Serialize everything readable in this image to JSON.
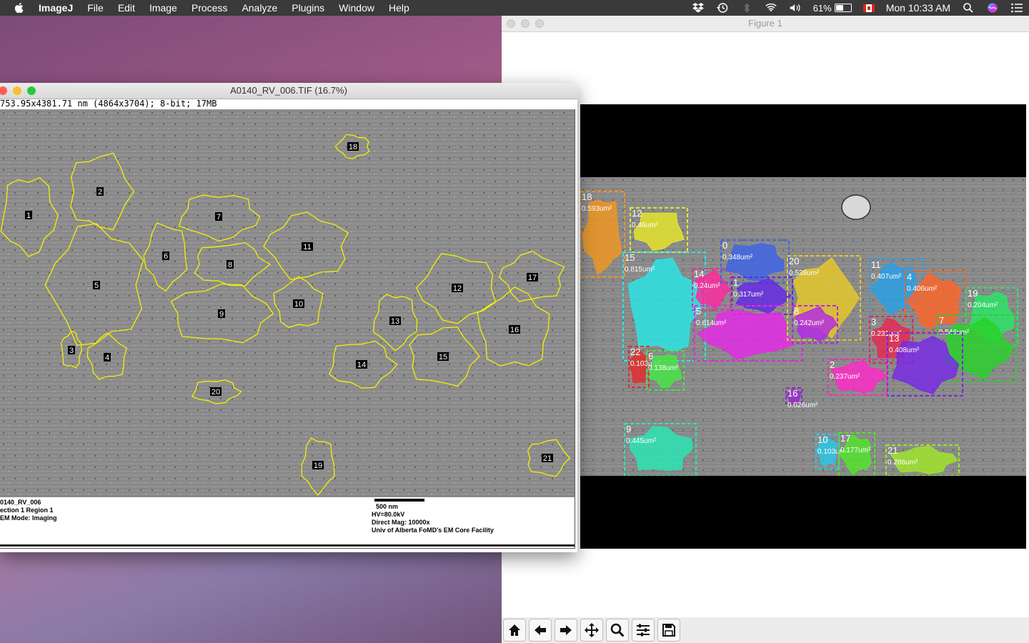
{
  "menubar": {
    "app_name": "ImageJ",
    "items": [
      "File",
      "Edit",
      "Image",
      "Process",
      "Analyze",
      "Plugins",
      "Window",
      "Help"
    ],
    "battery_percent": "61%",
    "battery_level": 0.61,
    "clock": "Mon 10:33 AM"
  },
  "figure_window": {
    "title": "Figure 1",
    "toolbar": [
      "home-icon",
      "back-arrow-icon",
      "forward-arrow-icon",
      "pan-icon",
      "zoom-icon",
      "configure-subplots-icon",
      "save-icon"
    ],
    "segments": [
      {
        "id": "18",
        "area": "0.593um²",
        "color": "#f0961e"
      },
      {
        "id": "12",
        "area": "0.46um²",
        "color": "#e6e628"
      },
      {
        "id": "15",
        "area": "0.815um²",
        "color": "#28e6e6"
      },
      {
        "id": "14",
        "area": "0.24um²",
        "color": "#ff28a0"
      },
      {
        "id": "0",
        "area": "0.348um²",
        "color": "#3c64e6"
      },
      {
        "id": "1",
        "area": "0.317um²",
        "color": "#6428e6"
      },
      {
        "id": "5",
        "area": "0.614um²",
        "color": "#e628e6"
      },
      {
        "id": "20",
        "area": "0.538um²",
        "color": "#e6c828"
      },
      {
        "id": "8",
        "area": "0.242um²",
        "color": "#b428e6"
      },
      {
        "id": "11",
        "area": "0.407um²",
        "color": "#28a0e6"
      },
      {
        "id": "4",
        "area": "0.406um²",
        "color": "#ff6428"
      },
      {
        "id": "19",
        "area": "0.204um²",
        "color": "#28e664"
      },
      {
        "id": "3",
        "area": "0.231um²",
        "color": "#e62850"
      },
      {
        "id": "7",
        "area": "0.546um²",
        "color": "#28d228"
      },
      {
        "id": "13",
        "area": "0.408um²",
        "color": "#7828e6"
      },
      {
        "id": "2",
        "area": "0.237um²",
        "color": "#ff28c8"
      },
      {
        "id": "22",
        "area": "0.103um²",
        "color": "#e62828"
      },
      {
        "id": "6",
        "area": "0.138um²",
        "color": "#46e646"
      },
      {
        "id": "16",
        "area": "0.026um²",
        "color": "#9628c8"
      },
      {
        "id": "9",
        "area": "0.445um²",
        "color": "#28e6b4"
      },
      {
        "id": "10",
        "area": "0.103um²",
        "color": "#28c8e6"
      },
      {
        "id": "17",
        "area": "0.177um²",
        "color": "#50e628"
      },
      {
        "id": "21",
        "area": "0.286um²",
        "color": "#a0e628"
      }
    ]
  },
  "imagej_window": {
    "title": "A0140_RV_006.TIF (16.7%)",
    "info": "753.95x4381.71 nm (4864x3704); 8-bit; 17MB",
    "roi_labels": [
      "1",
      "2",
      "3",
      "4",
      "5",
      "6",
      "7",
      "8",
      "9",
      "10",
      "11",
      "12",
      "13",
      "14",
      "15",
      "16",
      "17",
      "18",
      "19",
      "20",
      "21"
    ],
    "footer_left": [
      "0140_RV_006",
      "ection 1 Region 1",
      "EM Mode: Imaging"
    ],
    "footer_right": [
      "500 nm",
      "HV=80.0kV",
      "Direct Mag: 10000x",
      "Univ of Alberta FoMD's EM Core Facility"
    ]
  }
}
